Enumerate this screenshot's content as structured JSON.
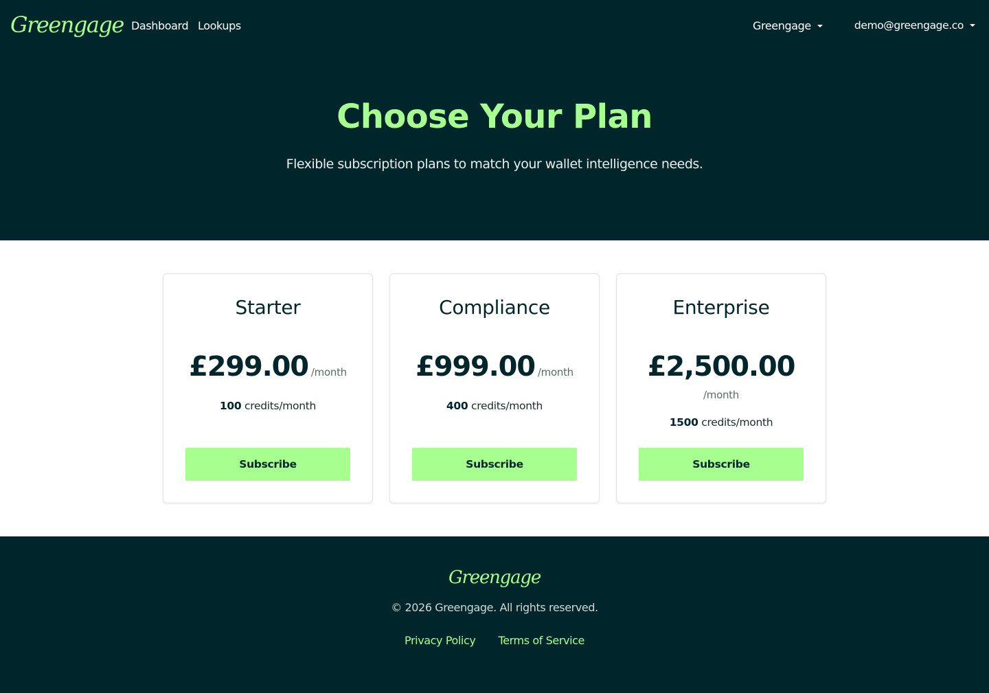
{
  "navbar": {
    "logo": "Greengage",
    "links": [
      "Dashboard",
      "Lookups"
    ],
    "org_dropdown": "Greengage",
    "user_dropdown": "demo@greengage.co"
  },
  "hero": {
    "title": "Choose Your Plan",
    "subtitle": "Flexible subscription plans to match your wallet intelligence needs."
  },
  "plans": [
    {
      "name": "Starter",
      "price": "£299.00",
      "period": "/month",
      "credits": "100",
      "credits_suffix": "credits/month",
      "button": "Subscribe"
    },
    {
      "name": "Compliance",
      "price": "£999.00",
      "period": "/month",
      "credits": "400",
      "credits_suffix": "credits/month",
      "button": "Subscribe"
    },
    {
      "name": "Enterprise",
      "price": "£2,500.00",
      "period": "/month",
      "credits": "1500",
      "credits_suffix": "credits/month",
      "button": "Subscribe"
    }
  ],
  "footer": {
    "logo": "Greengage",
    "copyright": "© 2026 Greengage. All rights reserved.",
    "links": [
      "Privacy Policy",
      "Terms of Service"
    ]
  },
  "colors": {
    "dark_background": "#00252a",
    "accent_green": "#a6ff8f",
    "card_border": "#dfe3e3"
  }
}
